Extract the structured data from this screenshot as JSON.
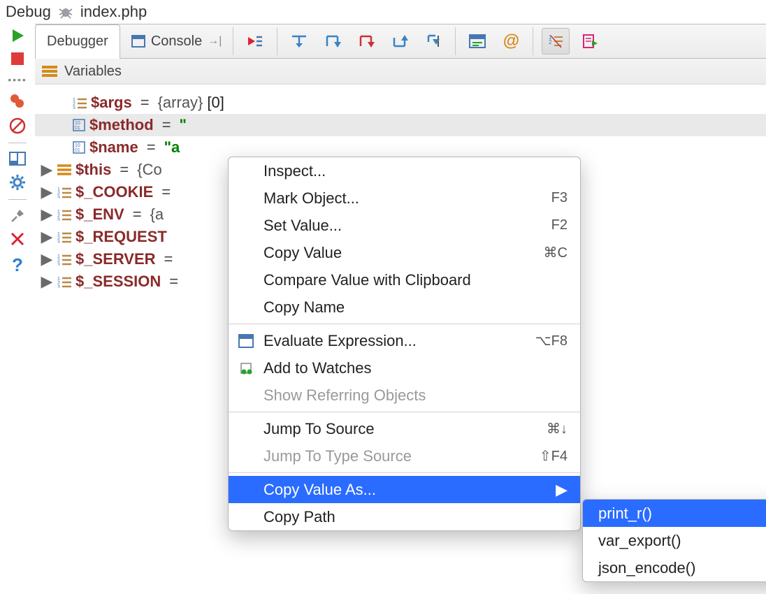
{
  "title": {
    "label": "Debug",
    "file": "index.php"
  },
  "tabs": {
    "debugger": "Debugger",
    "console": "Console"
  },
  "panel": {
    "variables": "Variables"
  },
  "vars": [
    {
      "name": "$args",
      "type_brace": "{array}",
      "suffix": " [0]",
      "icon": "list"
    },
    {
      "name": "$method",
      "eq": " = ",
      "val_truncated": "\"",
      "icon": "bin"
    },
    {
      "name": "$name",
      "eq": " = ",
      "val_truncated": "\"a",
      "icon": "bin"
    },
    {
      "name": "$this",
      "eq": " = ",
      "val_truncated": "{Co",
      "icon": "listbars",
      "expand": true
    },
    {
      "name": "$_COOKIE",
      "eq": " =",
      "icon": "list",
      "expand": true
    },
    {
      "name": "$_ENV",
      "eq": " = ",
      "val_truncated": "{a",
      "icon": "list",
      "expand": true
    },
    {
      "name": "$_REQUEST",
      "icon": "list",
      "expand": true
    },
    {
      "name": "$_SERVER",
      "eq": " =",
      "icon": "list",
      "expand": true
    },
    {
      "name": "$_SESSION",
      "eq": " =",
      "icon": "list",
      "expand": true
    }
  ],
  "menu": {
    "inspect": "Inspect...",
    "mark": "Mark Object...",
    "mark_key": "F3",
    "setval": "Set Value...",
    "setval_key": "F2",
    "copyval": "Copy Value",
    "copyval_key": "⌘C",
    "compare": "Compare Value with Clipboard",
    "copyname": "Copy Name",
    "eval": "Evaluate Expression...",
    "eval_key": "⌥F8",
    "watch": "Add to Watches",
    "refer": "Show Referring Objects",
    "jsrc": "Jump To Source",
    "jsrc_key": "⌘↓",
    "jtype": "Jump To Type Source",
    "jtype_key": "⇧F4",
    "copy_as": "Copy Value As...",
    "copy_path": "Copy Path"
  },
  "submenu": {
    "print_r": "print_r()",
    "var_export": "var_export()",
    "json_encode": "json_encode()"
  }
}
